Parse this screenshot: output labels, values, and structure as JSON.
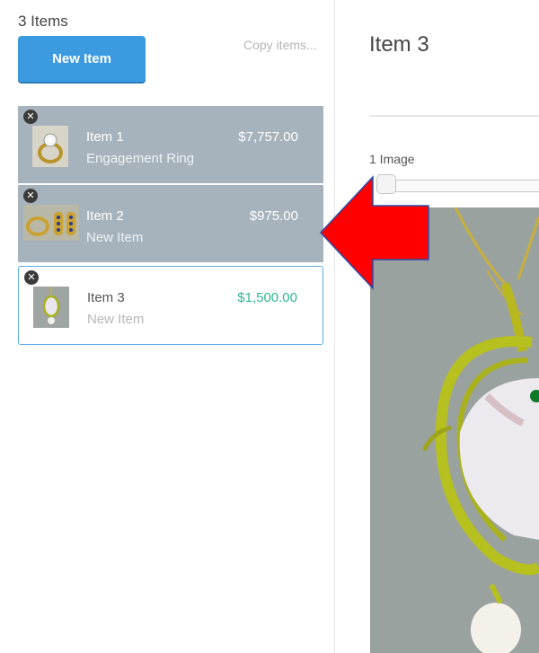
{
  "left": {
    "items_count": "3 Items",
    "new_item_label": "New Item",
    "copy_items_label": "Copy items..."
  },
  "items": [
    {
      "name": "Item 1",
      "subtitle": "Engagement Ring",
      "price": "$7,757.00",
      "selected": false
    },
    {
      "name": "Item 2",
      "subtitle": "New Item",
      "price": "$975.00",
      "selected": false
    },
    {
      "name": "Item 3",
      "subtitle": "New Item",
      "price": "$1,500.00",
      "selected": true
    }
  ],
  "detail": {
    "title": "Item 3",
    "image_count": "1 Image"
  },
  "icons": {
    "remove": "close-circle-icon"
  },
  "colors": {
    "primary_button": "#3c9be0",
    "row_background": "#a6b3bd",
    "selected_border": "#5bb0e6",
    "price_selected": "#2fb59a",
    "annotation_arrow": "#ff0000"
  }
}
